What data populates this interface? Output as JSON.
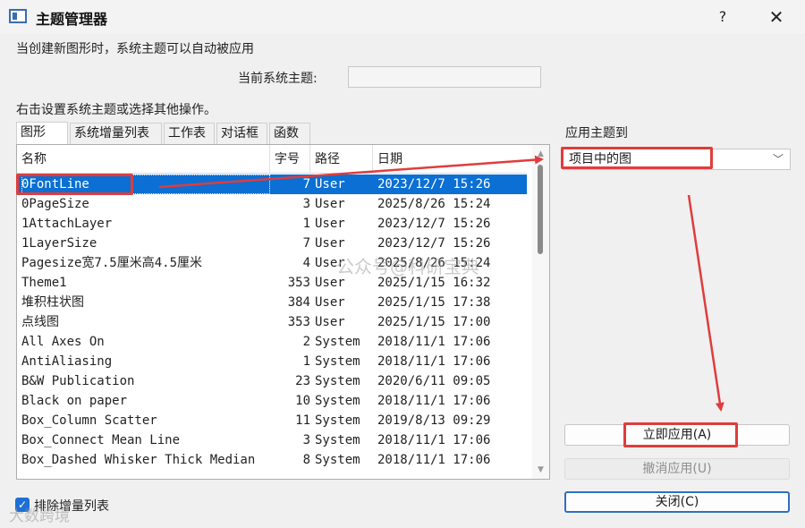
{
  "window": {
    "title": "主题管理器",
    "help_label": "?",
    "close_label": "✕"
  },
  "info": {
    "auto_apply_text": "当创建新图形时，系统主题可以自动被应用",
    "current_theme_label": "当前系统主题:",
    "current_theme_value": "",
    "right_click_hint": "右击设置系统主题或选择其他操作。"
  },
  "tabs": [
    "图形",
    "系统增量列表",
    "工作表",
    "对话框",
    "函数"
  ],
  "table": {
    "columns": [
      "名称",
      "字号",
      "路径",
      "日期"
    ],
    "rows": [
      {
        "name": "0FontLine",
        "num": "7",
        "path": "User",
        "date": "2023/12/7 15:26",
        "selected": true
      },
      {
        "name": "0PageSize",
        "num": "3",
        "path": "User",
        "date": "2025/8/26 15:24"
      },
      {
        "name": "1AttachLayer",
        "num": "1",
        "path": "User",
        "date": "2023/12/7 15:26"
      },
      {
        "name": "1LayerSize",
        "num": "7",
        "path": "User",
        "date": "2023/12/7 15:26"
      },
      {
        "name": "Pagesize宽7.5厘米高4.5厘米",
        "num": "4",
        "path": "User",
        "date": "2025/8/26 15:24"
      },
      {
        "name": "Theme1",
        "num": "353",
        "path": "User",
        "date": "2025/1/15 16:32"
      },
      {
        "name": "堆积柱状图",
        "num": "384",
        "path": "User",
        "date": "2025/1/15 17:38"
      },
      {
        "name": "点线图",
        "num": "353",
        "path": "User",
        "date": "2025/1/15 17:00"
      },
      {
        "name": "All Axes On",
        "num": "2",
        "path": "System",
        "date": "2018/11/1 17:06"
      },
      {
        "name": "AntiAliasing",
        "num": "1",
        "path": "System",
        "date": "2018/11/1 17:06"
      },
      {
        "name": "B&W Publication",
        "num": "23",
        "path": "System",
        "date": "2020/6/11 09:05"
      },
      {
        "name": "Black on paper",
        "num": "10",
        "path": "System",
        "date": "2018/11/1 17:06"
      },
      {
        "name": "Box_Column Scatter",
        "num": "11",
        "path": "System",
        "date": "2019/8/13 09:29"
      },
      {
        "name": "Box_Connect Mean Line",
        "num": "3",
        "path": "System",
        "date": "2018/11/1 17:06"
      },
      {
        "name": "Box_Dashed Whisker Thick Median",
        "num": "8",
        "path": "System",
        "date": "2018/11/1 17:06"
      }
    ]
  },
  "apply_panel": {
    "label": "应用主题到",
    "combo_value": "项目中的图",
    "apply_now": "立即应用(A)",
    "undo_apply": "撤消应用(U)",
    "close": "关闭(C)"
  },
  "footer": {
    "exclude_label": "排除增量列表",
    "exclude_checked": true
  },
  "watermarks": {
    "center": "公众号@科研宝典",
    "bottom": "大数跨境"
  },
  "colors": {
    "selection": "#0b6fd3",
    "annotation": "#e03c3c"
  }
}
